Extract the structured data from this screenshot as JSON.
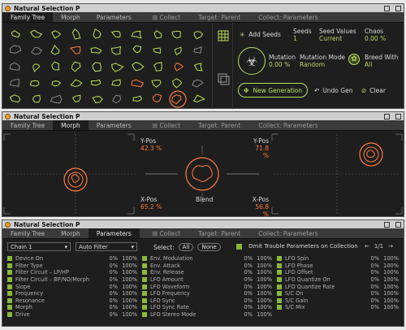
{
  "app_title": "Natural Selection P",
  "tabs": {
    "family_tree": "Family Tree",
    "morph": "Morph",
    "parameters": "Parameters"
  },
  "header": {
    "collect_icon_label": "Collect",
    "target": "Target: Parent",
    "collect": "Collect: Parameters"
  },
  "family_tree": {
    "add_seeds": "Add Seeds",
    "seeds_label": "Seeds",
    "seeds_value": "1",
    "seed_values_label": "Seed Values",
    "seed_values_value": "Current",
    "chaos_label": "Chaos",
    "chaos_value": "0.00 %",
    "mutation_label": "Mutation",
    "mutation_value": "0.00 %",
    "mutation_mode_label": "Mutation Mode",
    "mutation_mode_value": "Random",
    "breed_with_label": "Breed With",
    "breed_with_value": "All",
    "new_generation": "New Generation",
    "undo_gen": "Undo Gen",
    "clear": "Clear"
  },
  "morph": {
    "y_pos_left_label": "Y-Pos",
    "y_pos_left_value": "42.3 %",
    "x_pos_left_label": "X-Pos",
    "x_pos_left_value": "65.2 %",
    "y_pos_right_label": "Y-Pos",
    "y_pos_right_value": "71.8 %",
    "x_pos_right_label": "X-Pos",
    "x_pos_right_value": "56.8 %",
    "blend_label": "Blend"
  },
  "parameters": {
    "chain_select": "Chain 1",
    "filter_select": "Auto Filter",
    "select_label": "Select:",
    "all_button": "All",
    "none_button": "None",
    "omit_label": "Omit Trouble Parameters on Collection",
    "page_indicator": "1/1",
    "col1": [
      {
        "name": "Device On",
        "min": "0%",
        "max": "100%"
      },
      {
        "name": "Filter Type",
        "min": "0%",
        "max": "100%"
      },
      {
        "name": "Filter Circuit – LP/HP",
        "min": "0%",
        "max": "100%"
      },
      {
        "name": "Filter Circuit – BP/NO/Morph",
        "min": "0%",
        "max": "100%"
      },
      {
        "name": "Slope",
        "min": "0%",
        "max": "100%"
      },
      {
        "name": "Frequency",
        "min": "0%",
        "max": "100%"
      },
      {
        "name": "Resonance",
        "min": "0%",
        "max": "100%"
      },
      {
        "name": "Morph",
        "min": "0%",
        "max": "100%"
      },
      {
        "name": "Drive",
        "min": "0%",
        "max": "100%"
      }
    ],
    "col2": [
      {
        "name": "Env. Modulation",
        "min": "0%",
        "max": "100%"
      },
      {
        "name": "Env. Attack",
        "min": "0%",
        "max": "100%"
      },
      {
        "name": "Env. Release",
        "min": "0%",
        "max": "100%"
      },
      {
        "name": "LFO Amount",
        "min": "0%",
        "max": "100%"
      },
      {
        "name": "LFO Waveform",
        "min": "0%",
        "max": "100%"
      },
      {
        "name": "LFO Frequency",
        "min": "0%",
        "max": "100%"
      },
      {
        "name": "LFO Sync",
        "min": "0%",
        "max": "100%"
      },
      {
        "name": "LFO Sync Rate",
        "min": "0%",
        "max": "100%"
      },
      {
        "name": "LFO Stereo Mode",
        "min": "0%",
        "max": "100%"
      }
    ],
    "col3": [
      {
        "name": "LFO Spin",
        "min": "0%",
        "max": "100%"
      },
      {
        "name": "LFO Phase",
        "min": "0%",
        "max": "100%"
      },
      {
        "name": "LFO Offset",
        "min": "0%",
        "max": "100%"
      },
      {
        "name": "LFO Quantize On",
        "min": "0%",
        "max": "100%"
      },
      {
        "name": "LFO Quantize Rate",
        "min": "0%",
        "max": "100%"
      },
      {
        "name": "S/C On",
        "min": "0%",
        "max": "100%"
      },
      {
        "name": "S/C Gain",
        "min": "0%",
        "max": "100%"
      },
      {
        "name": "S/C Mix",
        "min": "0%",
        "max": "100%"
      },
      {
        "name": "",
        "min": "",
        "max": ""
      }
    ]
  },
  "colors": {
    "orange": "#ff7a3c",
    "green": "#b9e05a",
    "grey_shape": "#8a8a8a",
    "accent_chk": "#8ab83a"
  }
}
